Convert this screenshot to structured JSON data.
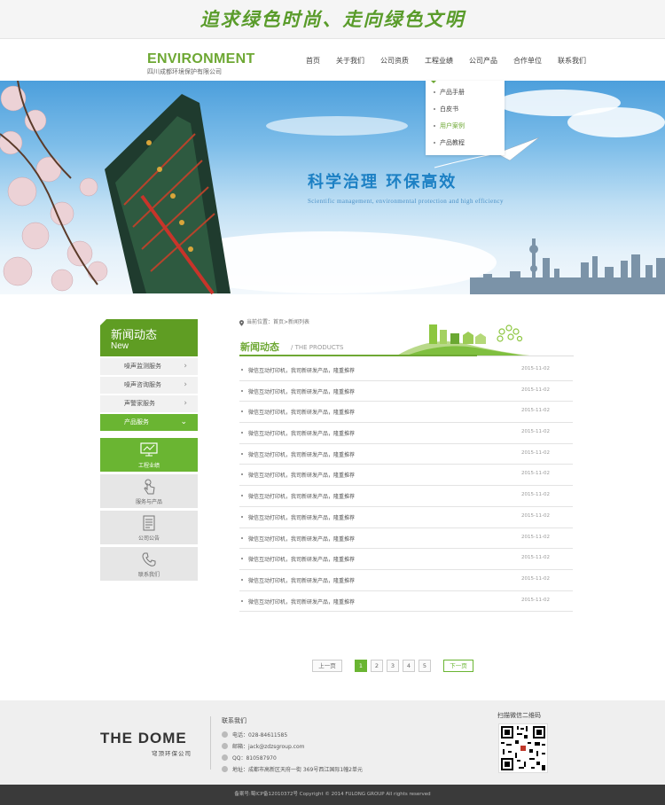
{
  "top": {
    "slogan": "追求绿色时尚、走向绿色文明"
  },
  "header": {
    "logo_en": "ENVIRONMENT",
    "logo_cn": "四川成都环境保护有限公司",
    "nav": [
      "首页",
      "关于我们",
      "公司资质",
      "工程业绩",
      "公司产品",
      "合作单位",
      "联系我们"
    ]
  },
  "dropdown": {
    "items": [
      "产品手册",
      "白皮书",
      "用户案例",
      "产品教程"
    ],
    "active_index": 2
  },
  "banner": {
    "title": "科学治理  环保高效",
    "subtitle": "Scientific management, environmental protection and high efficiency"
  },
  "sidebar": {
    "title": "新闻动态",
    "subtitle": "New",
    "items": [
      "噪声监测服务",
      "噪声咨询服务",
      "声警家服务",
      "产品服务"
    ],
    "active_index": 3,
    "tiles": [
      {
        "label": "工程业绩",
        "icon": "monitor-icon",
        "active": true
      },
      {
        "label": "服务与产品",
        "icon": "hand-touch-icon",
        "active": false
      },
      {
        "label": "公司公告",
        "icon": "document-icon",
        "active": false
      },
      {
        "label": "联系我们",
        "icon": "phone-icon",
        "active": false
      }
    ]
  },
  "main": {
    "breadcrumb": "当前位置：首页>新闻列表",
    "section_title": "新闻动态",
    "section_sub": "/ THE PRODUCTS",
    "news": [
      {
        "title": "微信互动打印机，我司新研发产品，隆重推荐",
        "date": "2015-11-02"
      },
      {
        "title": "微信互动打印机，我司新研发产品，隆重推荐",
        "date": "2015-11-02"
      },
      {
        "title": "微信互动打印机，我司新研发产品，隆重推荐",
        "date": "2015-11-02"
      },
      {
        "title": "微信互动打印机，我司新研发产品，隆重推荐",
        "date": "2015-11-02"
      },
      {
        "title": "微信互动打印机，我司新研发产品，隆重推荐",
        "date": "2015-11-02"
      },
      {
        "title": "微信互动打印机，我司新研发产品，隆重推荐",
        "date": "2015-11-02"
      },
      {
        "title": "微信互动打印机，我司新研发产品，隆重推荐",
        "date": "2015-11-02"
      },
      {
        "title": "微信互动打印机，我司新研发产品，隆重推荐",
        "date": "2015-11-02"
      },
      {
        "title": "微信互动打印机，我司新研发产品，隆重推荐",
        "date": "2015-11-02"
      },
      {
        "title": "微信互动打印机，我司新研发产品，隆重推荐",
        "date": "2015-11-02"
      },
      {
        "title": "微信互动打印机，我司新研发产品，隆重推荐",
        "date": "2015-11-02"
      },
      {
        "title": "微信互动打印机，我司新研发产品，隆重推荐",
        "date": "2015-11-02"
      }
    ]
  },
  "pager": {
    "prev": "上一页",
    "pages": [
      "1",
      "2",
      "3",
      "4",
      "5"
    ],
    "current": "1",
    "next": "下一页"
  },
  "footer": {
    "logo": "THE DOME",
    "logo_cn": "穹顶环保公司",
    "contact_title": "联系我们",
    "phone": "电话：028-84611585",
    "email": "邮箱：jack@zdzsgroup.com",
    "qq": "QQ：810587970",
    "address": "地址：成都市高新区天府一街 369号西江国际1幢2单元",
    "qr_title": "扫描微信二维码",
    "copyright": "备案号:蜀ICP备12010372号 Copyright © 2014 FULONG GROUP All rights reserved"
  },
  "colors": {
    "accent": "#6ab532",
    "brand_green": "#6ea834",
    "footer_bg": "#efefef",
    "copy_bg": "#3a3a3a"
  }
}
